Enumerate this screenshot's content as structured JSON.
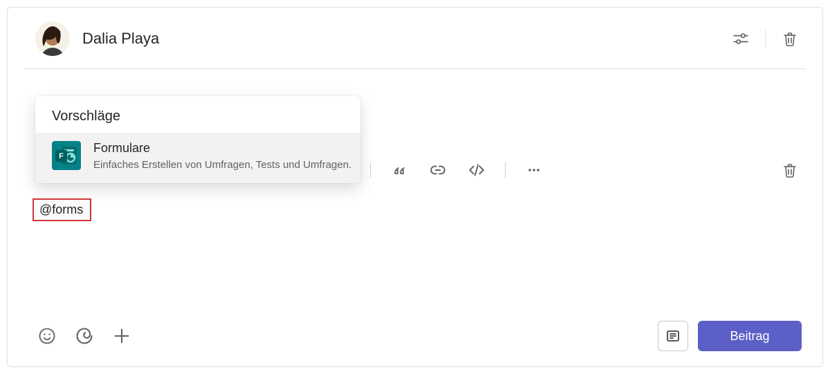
{
  "author": {
    "name": "Dalia Playa"
  },
  "suggestions": {
    "title": "Vorschläge",
    "items": [
      {
        "name": "Formulare",
        "description": "Einfaches Erstellen von Umfragen, Tests und Umfragen."
      }
    ]
  },
  "compose": {
    "mention_text": "@forms"
  },
  "actions": {
    "post_label": "Beitrag"
  },
  "icons": {
    "settings": "settings-sliders-icon",
    "delete": "trash-icon",
    "quote": "quote-icon",
    "link": "link-icon",
    "code": "code-icon",
    "more": "more-icon",
    "emoji": "emoji-icon",
    "loop": "loop-component-icon",
    "add": "plus-icon",
    "post_options": "compose-options-icon"
  }
}
